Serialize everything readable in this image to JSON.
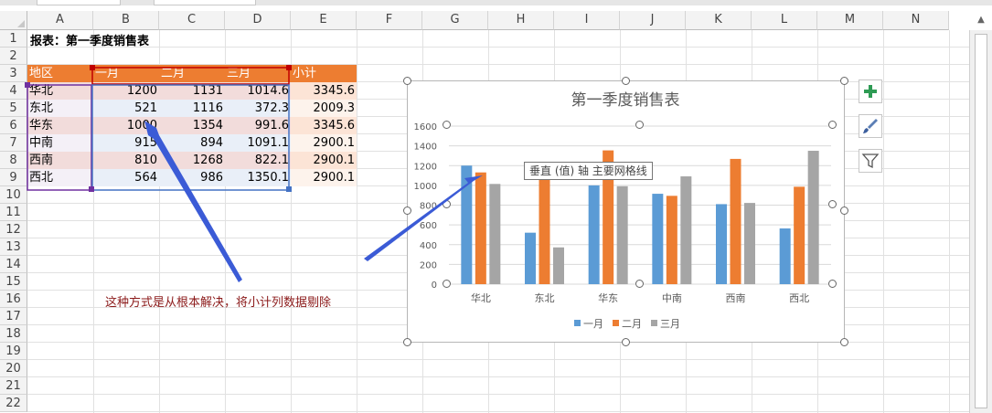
{
  "columns": [
    "A",
    "B",
    "C",
    "D",
    "E",
    "F",
    "G",
    "H",
    "I",
    "J",
    "K",
    "L",
    "M",
    "N"
  ],
  "rows": [
    "1",
    "2",
    "3",
    "4",
    "5",
    "6",
    "7",
    "8",
    "9",
    "10",
    "11",
    "12",
    "13",
    "14",
    "15",
    "16",
    "17",
    "18",
    "19",
    "20",
    "21",
    "22"
  ],
  "sheet": {
    "title": "报表：第一季度销售表",
    "headers": [
      "地区",
      "一月",
      "二月",
      "三月",
      "小计"
    ],
    "data": [
      [
        "华北",
        "1200",
        "1131",
        "1014.6",
        "3345.6"
      ],
      [
        "东北",
        "521",
        "1116",
        "372.3",
        "2009.3"
      ],
      [
        "华东",
        "1000",
        "1354",
        "991.6",
        "3345.6"
      ],
      [
        "中南",
        "915",
        "894",
        "1091.1",
        "2900.1"
      ],
      [
        "西南",
        "810",
        "1268",
        "822.1",
        "2900.1"
      ],
      [
        "西北",
        "564",
        "986",
        "1350.1",
        "2900.1"
      ]
    ]
  },
  "annotation_text": "这种方式是从根本解决，将小计列数据剔除",
  "tooltip_text": "垂直 (值) 轴 主要网格线",
  "colors": {
    "header_fill": "#ed7d31",
    "series1": "#5b9bd5",
    "series2": "#ed7d31",
    "series3": "#a5a5a5",
    "selection_blue": "#4472c4",
    "selection_purple": "#7030a0",
    "selection_red": "#c00000",
    "arrow": "#3b5bd6"
  },
  "icons": {
    "add_element": "plus-icon",
    "styles": "paintbrush-icon",
    "filter": "funnel-icon"
  },
  "chart_data": {
    "type": "bar",
    "title": "第一季度销售表",
    "categories": [
      "华北",
      "东北",
      "华东",
      "中南",
      "西南",
      "西北"
    ],
    "series": [
      {
        "name": "一月",
        "values": [
          1200,
          521,
          1000,
          915,
          810,
          564
        ]
      },
      {
        "name": "二月",
        "values": [
          1131,
          1116,
          1354,
          894,
          1268,
          986
        ]
      },
      {
        "name": "三月",
        "values": [
          1014.6,
          372.3,
          991.6,
          1091.1,
          822.1,
          1350.1
        ]
      }
    ],
    "yticks": [
      "0",
      "200",
      "400",
      "600",
      "800",
      "1000",
      "1200",
      "1400",
      "1600"
    ],
    "ylim": [
      0,
      1600
    ],
    "grid": true,
    "legend_position": "bottom"
  }
}
